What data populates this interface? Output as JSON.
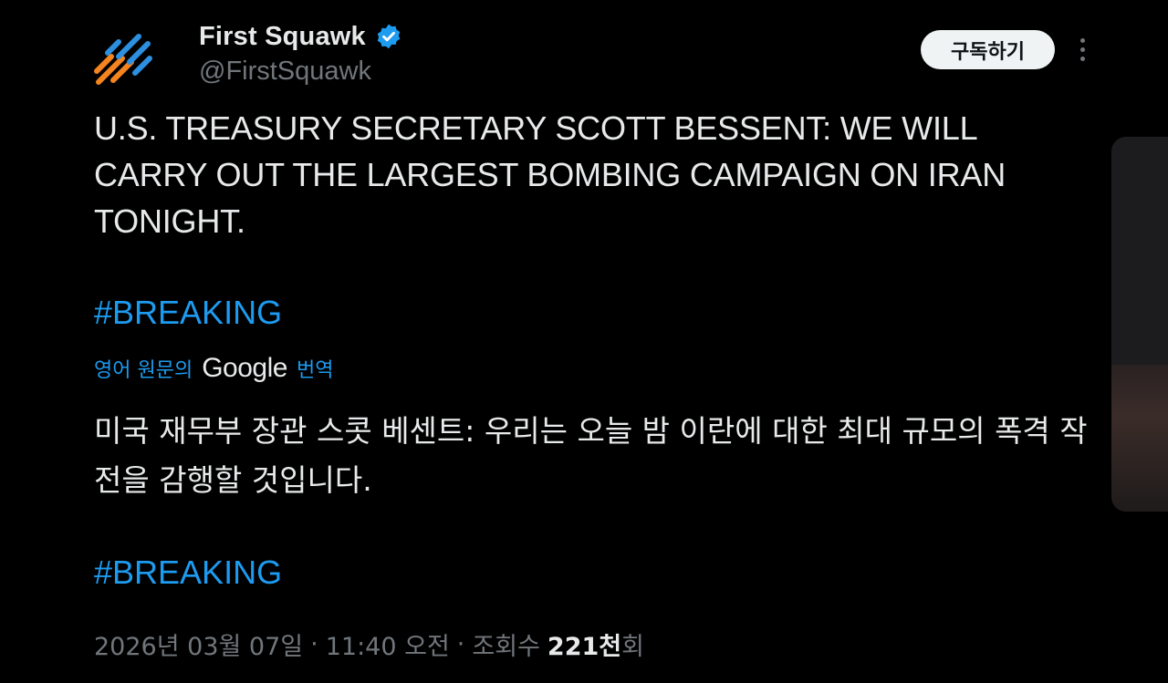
{
  "author": {
    "display_name": "First Squawk",
    "handle": "@FirstSquawk",
    "verified": true,
    "avatar_icon": "firstsquawk-logo-icon",
    "avatar_colors": [
      "#f5841f",
      "#2d8fe0"
    ]
  },
  "actions": {
    "subscribe_label": "구독하기",
    "more_icon": "more-vertical-icon"
  },
  "tweet": {
    "text": "U.S. TREASURY SECRETARY SCOTT BESSENT: WE WILL CARRY OUT THE LARGEST BOMBING CAMPAIGN ON IRAN TONIGHT.",
    "hashtag": "#BREAKING"
  },
  "translation": {
    "prefix": "영어 원문의",
    "provider": "Google",
    "suffix": "번역",
    "text": "미국 재무부 장관 스콧 베센트: 우리는 오늘 밤 이란에 대한 최대 규모의 폭격 작전을 감행할 것입니다.",
    "hashtag": "#BREAKING"
  },
  "meta": {
    "date": "2026년 03월 07일",
    "separator": "·",
    "time": "11:40 오전",
    "views_label": "조회수",
    "views_count": "221천",
    "views_suffix": "회"
  },
  "colors": {
    "background": "#000000",
    "text": "#e7e9ea",
    "secondary": "#71767b",
    "link": "#1d9bf0"
  }
}
